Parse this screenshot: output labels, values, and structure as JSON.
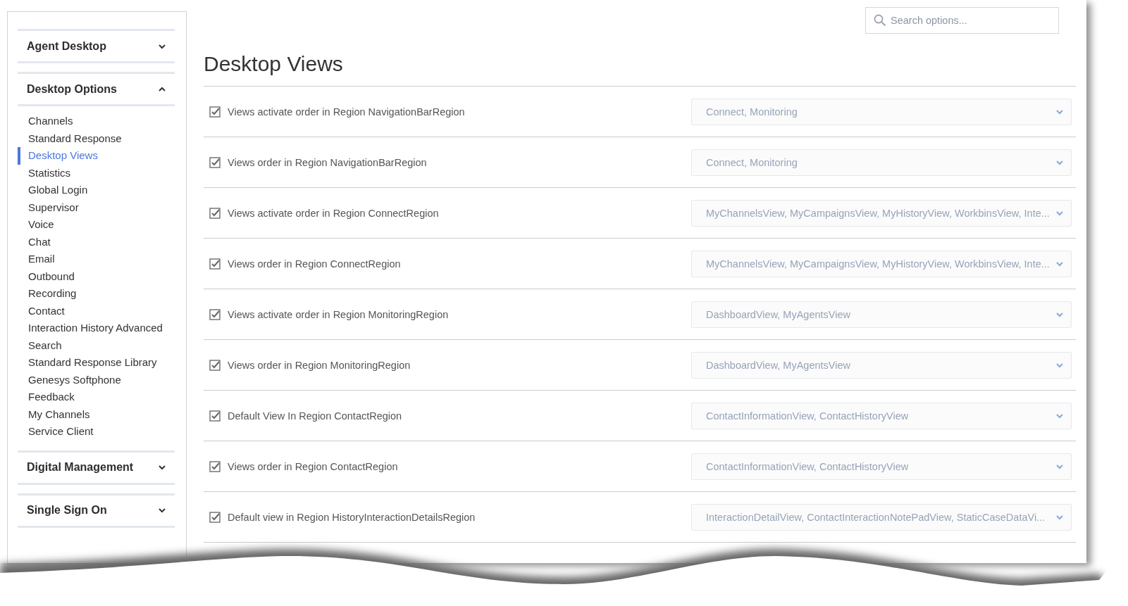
{
  "sidebar": {
    "sections": [
      {
        "title": "Agent Desktop",
        "expanded": false
      },
      {
        "title": "Desktop Options",
        "expanded": true,
        "items": [
          {
            "label": "Channels",
            "selected": false
          },
          {
            "label": "Standard Response",
            "selected": false
          },
          {
            "label": "Desktop Views",
            "selected": true
          },
          {
            "label": "Statistics",
            "selected": false
          },
          {
            "label": "Global Login",
            "selected": false
          },
          {
            "label": "Supervisor",
            "selected": false
          },
          {
            "label": "Voice",
            "selected": false
          },
          {
            "label": "Chat",
            "selected": false
          },
          {
            "label": "Email",
            "selected": false
          },
          {
            "label": "Outbound",
            "selected": false
          },
          {
            "label": "Recording",
            "selected": false
          },
          {
            "label": "Contact",
            "selected": false
          },
          {
            "label": "Interaction History Advanced",
            "selected": false
          },
          {
            "label": "Search",
            "selected": false
          },
          {
            "label": "Standard Response Library",
            "selected": false
          },
          {
            "label": "Genesys Softphone",
            "selected": false
          },
          {
            "label": "Feedback",
            "selected": false
          },
          {
            "label": "My Channels",
            "selected": false
          },
          {
            "label": "Service Client",
            "selected": false
          }
        ]
      },
      {
        "title": "Digital Management",
        "expanded": false
      },
      {
        "title": "Single Sign On",
        "expanded": false
      }
    ]
  },
  "search": {
    "placeholder": "Search options..."
  },
  "title": "Desktop Views",
  "options": [
    {
      "label": "Views activate order in Region NavigationBarRegion",
      "checked": true,
      "value": "Connect, Monitoring"
    },
    {
      "label": "Views order in Region NavigationBarRegion",
      "checked": true,
      "value": "Connect, Monitoring"
    },
    {
      "label": "Views activate order in Region ConnectRegion",
      "checked": true,
      "value": "MyChannelsView, MyCampaignsView, MyHistoryView, WorkbinsView, Inte..."
    },
    {
      "label": "Views order in Region ConnectRegion",
      "checked": true,
      "value": "MyChannelsView, MyCampaignsView, MyHistoryView, WorkbinsView, Inte..."
    },
    {
      "label": "Views activate order in Region MonitoringRegion",
      "checked": true,
      "value": "DashboardView, MyAgentsView"
    },
    {
      "label": "Views order in Region MonitoringRegion",
      "checked": true,
      "value": "DashboardView, MyAgentsView"
    },
    {
      "label": "Default View In Region ContactRegion",
      "checked": true,
      "value": "ContactInformationView, ContactHistoryView"
    },
    {
      "label": "Views order in Region ContactRegion",
      "checked": true,
      "value": "ContactInformationView, ContactHistoryView"
    },
    {
      "label": "Default view in Region HistoryInteractionDetailsRegion",
      "checked": true,
      "value": "InteractionDetailView, ContactInteractionNotePadView, StaticCaseDataVi..."
    }
  ]
}
